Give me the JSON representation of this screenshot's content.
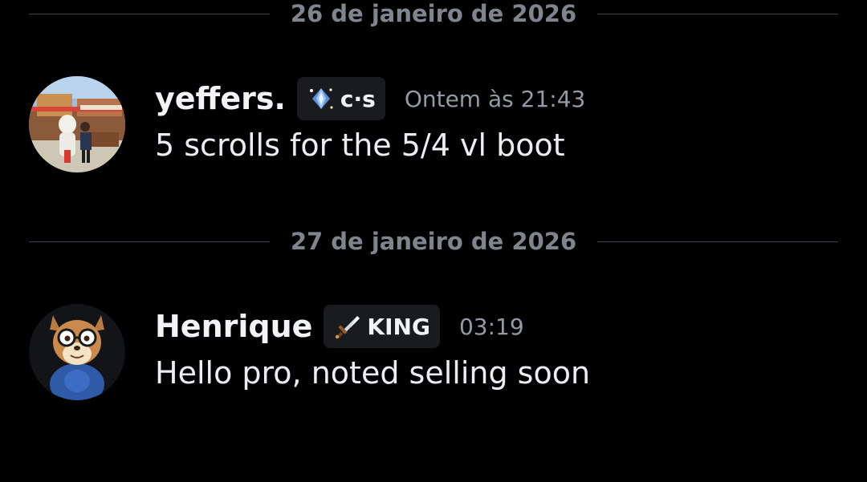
{
  "dividers": [
    {
      "date": "26 de janeiro de 2026"
    },
    {
      "date": "27 de janeiro de 2026"
    }
  ],
  "messages": [
    {
      "username": "yeffers.",
      "tag": {
        "text": "c·s",
        "icon": "diamond-sparkle-icon"
      },
      "timestamp": "Ontem às 21:43",
      "content": "5 scrolls for the 5/4 vl boot",
      "avatar": "photo-avatar"
    },
    {
      "username": "Henrique",
      "tag": {
        "text": "KING",
        "icon": "sword-icon"
      },
      "timestamp": "03:19",
      "content": "Hello pro, noted selling soon",
      "avatar": "chipmunk-avatar"
    }
  ],
  "colors": {
    "background": "#000000",
    "username": "#f2f3f5",
    "timestamp": "#949ba4",
    "divider_text": "#80848e",
    "divider_line": "#3f4147",
    "tag_background": "#1a1b1e"
  }
}
